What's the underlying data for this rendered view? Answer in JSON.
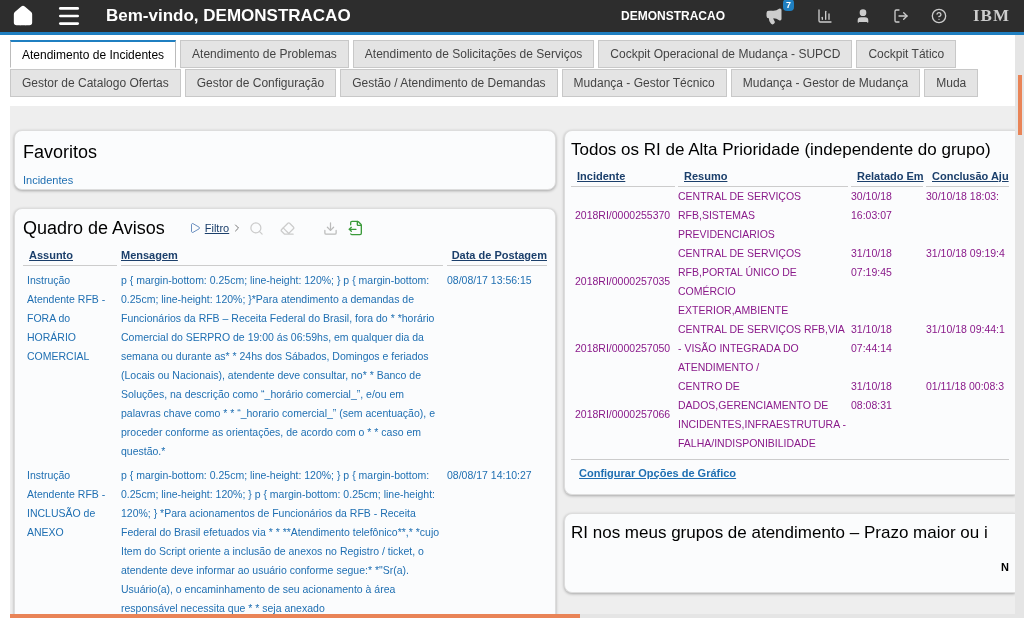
{
  "header": {
    "title": "Bem-vindo, DEMONSTRACAO",
    "user": "DEMONSTRACAO",
    "notifications": "7",
    "logo": "IBM"
  },
  "tabs_row_1": [
    {
      "label": "Atendimento de Incidentes",
      "selected": true
    },
    {
      "label": "Atendimento de Problemas",
      "selected": false
    },
    {
      "label": "Atendimento de Solicitações de Serviços",
      "selected": false
    },
    {
      "label": "Cockpit Operacional de Mudança - SUPCD",
      "selected": false
    },
    {
      "label": "Cockpit Tático",
      "selected": false
    }
  ],
  "tabs_row_2": [
    {
      "label": "Gestor de Catalogo Ofertas",
      "selected": false
    },
    {
      "label": "Gestor de Configuração",
      "selected": false
    },
    {
      "label": "Gestão / Atendimento de Demandas",
      "selected": false
    },
    {
      "label": "Mudança - Gestor Técnico",
      "selected": false
    },
    {
      "label": "Mudança - Gestor de Mudança",
      "selected": false
    },
    {
      "label": "Muda",
      "selected": false
    }
  ],
  "favoritos": {
    "title": "Favoritos",
    "links": [
      "Incidentes"
    ]
  },
  "quadro_de_avisos": {
    "title": "Quadro de Avisos",
    "filter": "Filtro",
    "columns": [
      "Assunto",
      "Mensagem",
      "Data de Postagem"
    ],
    "rows": [
      {
        "assunto": "Instrução Atendente RFB - FORA do HORÁRIO COMERCIAL",
        "mensagem": "p { margin-bottom: 0.25cm; line-height: 120%; } p { margin-bottom: 0.25cm; line-height: 120%; }*Para atendimento a demandas de Funcionários da RFB – Receita Federal do Brasil, fora do * *horário Comercial do SERPRO de 19:00 ás 06:59hs, em qualquer dia da semana ou durante as* * 24hs dos Sábados, Domingos e feriados (Locais ou Nacionais), atendente deve consultar, no* * Banco de Soluções, na descrição como “_horário comercial_”, e/ou em palavras chave como * * “_horario comercial_” (sem acentuação), e proceder conforme as orientações, de acordo com o * * caso em questão.*",
        "data": "08/08/17 13:56:15"
      },
      {
        "assunto": "Instrução Atendente RFB - INCLUSÃO de ANEXO",
        "mensagem": "p { margin-bottom: 0.25cm; line-height: 120%; } p { margin-bottom: 0.25cm; line-height: 120%; } p { margin-bottom: 0.25cm; line-height: 120%; } *Para acionamentos de Funcionários da RFB - Receita Federal do Brasil efetuados via * * **Atendimento telefônico**,* *cujo Item do Script oriente a inclusão de anexos no Registro / ticket, o atendente deve informar ao usuário conforme segue:* *\"Sr(a). Usuário(a), o encaminhamento de seu acionamento à área responsável necessita que * * seja anexado",
        "data": "08/08/17 14:10:27"
      }
    ]
  },
  "alta_prioridade": {
    "title": "Todos os RI de Alta Prioridade (independente do grupo)",
    "columns": [
      "Incidente",
      "Resumo",
      "Relatado Em",
      "Conclusão Aju"
    ],
    "rows": [
      {
        "incidente": "2018RI/0000255370",
        "resumo": "CENTRAL DE SERVIÇOS RFB,SISTEMAS PREVIDENCIARIOS",
        "relatado": "30/10/18 16:03:07",
        "conclusao": "30/10/18 18:03:"
      },
      {
        "incidente": "2018RI/0000257035",
        "resumo": "CENTRAL DE SERVIÇOS RFB,PORTAL ÚNICO DE COMÉRCIO EXTERIOR,AMBIENTE",
        "relatado": "31/10/18 07:19:45",
        "conclusao": "31/10/18 09:19:4"
      },
      {
        "incidente": "2018RI/0000257050",
        "resumo": "CENTRAL DE SERVIÇOS RFB,VIA - VISÃO INTEGRADA DO ATENDIMENTO /",
        "relatado": "31/10/18 07:44:14",
        "conclusao": "31/10/18 09:44:1"
      },
      {
        "incidente": "2018RI/0000257066",
        "resumo": "CENTRO DE DADOS,GERENCIAMENTO DE INCIDENTES,INFRAESTRUTURA - FALHA/INDISPONIBILIDADE",
        "relatado": "31/10/18 08:08:31",
        "conclusao": "01/11/18 00:08:3"
      }
    ],
    "footer_link": "Configurar Opções de Gráfico"
  },
  "prazo": {
    "title": "RI nos meus grupos de atendimento – Prazo maior ou i",
    "column_1": "N"
  }
}
